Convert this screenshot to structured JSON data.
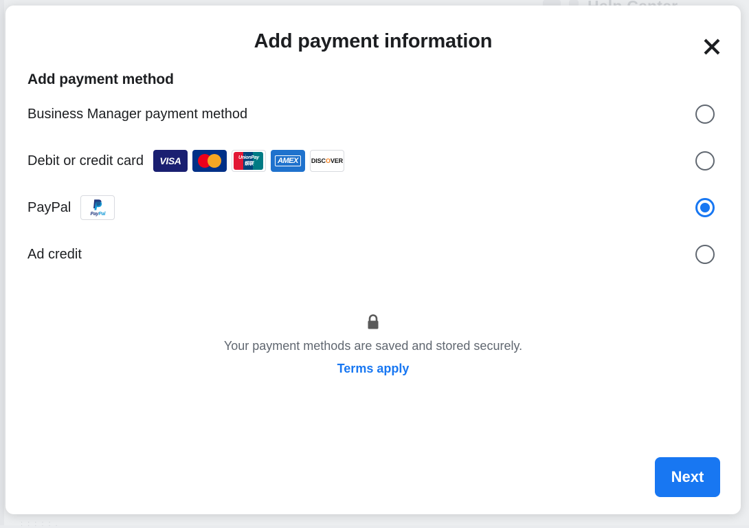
{
  "background": {
    "help_center_label": "Help Center",
    "bottom_hint": ": :   : :    : .",
    "right_edge_text": ""
  },
  "dialog": {
    "title": "Add payment information",
    "close_icon": "close-icon",
    "section_heading": "Add payment method",
    "options": [
      {
        "id": "business-manager",
        "label": "Business Manager payment method",
        "selected": false,
        "logos": []
      },
      {
        "id": "debit-credit-card",
        "label": "Debit or credit card",
        "selected": false,
        "logos": [
          "visa",
          "mastercard",
          "unionpay",
          "amex",
          "discover"
        ]
      },
      {
        "id": "paypal",
        "label": "PayPal",
        "selected": true,
        "logos": [
          "paypal"
        ]
      },
      {
        "id": "ad-credit",
        "label": "Ad credit",
        "selected": false,
        "logos": []
      }
    ],
    "secure": {
      "icon": "lock-icon",
      "text": "Your payment methods are saved and stored securely.",
      "terms_label": "Terms apply"
    },
    "footer": {
      "next_label": "Next"
    }
  },
  "logos": {
    "visa": {
      "text": "VISA"
    },
    "mastercard": {
      "text": ""
    },
    "unionpay": {
      "line1": "UnionPay",
      "line2": "银联"
    },
    "amex": {
      "text": "AMEX"
    },
    "discover": {
      "prefix": "DISC",
      "accent": "O",
      "suffix": "VER"
    },
    "paypal": {
      "word_a": "Pay",
      "word_b": "Pal"
    }
  },
  "colors": {
    "accent": "#1877f2",
    "text_primary": "#1c1e21",
    "text_secondary": "#606770",
    "visa_bg": "#1a1f71",
    "mastercard_bg": "#003087",
    "mastercard_red": "#eb001b",
    "mastercard_yellow": "#f5a623",
    "amex_bg": "#1f72cd",
    "discover_accent": "#f58220",
    "unionpay_red": "#e21836",
    "unionpay_blue": "#00447c",
    "unionpay_green": "#007b84"
  }
}
